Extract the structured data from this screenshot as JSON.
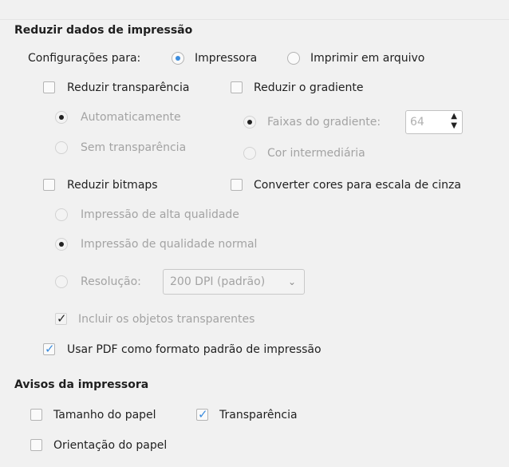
{
  "reduce": {
    "title": "Reduzir dados de impressão",
    "settings_for_label": "Configurações para:",
    "printer_label": "Impressora",
    "print_to_file_label": "Imprimir em arquivo",
    "reduce_transparency_label": "Reduzir transparência",
    "automatic_label": "Automaticamente",
    "no_transparency_label": "Sem transparência",
    "reduce_gradient_label": "Reduzir o gradiente",
    "gradient_stripes_label": "Faixas do gradiente:",
    "gradient_stripes_value": "64",
    "intermediate_color_label": "Cor intermediária",
    "reduce_bitmaps_label": "Reduzir bitmaps",
    "high_quality_label": "Impressão de alta qualidade",
    "normal_quality_label": "Impressão de qualidade normal",
    "resolution_label": "Resolução:",
    "resolution_value": "200 DPI (padrão)",
    "include_transparent_label": "Incluir os objetos transparentes",
    "convert_gray_label": "Converter cores para escala de cinza",
    "pdf_default_label": "Usar PDF como formato padrão de impressão"
  },
  "warnings": {
    "title": "Avisos da impressora",
    "paper_size_label": "Tamanho do papel",
    "transparency_label": "Transparência",
    "paper_orientation_label": "Orientação do papel"
  },
  "colors": {
    "accent": "#3c8dde",
    "disabled_text": "#a3a3a3"
  }
}
